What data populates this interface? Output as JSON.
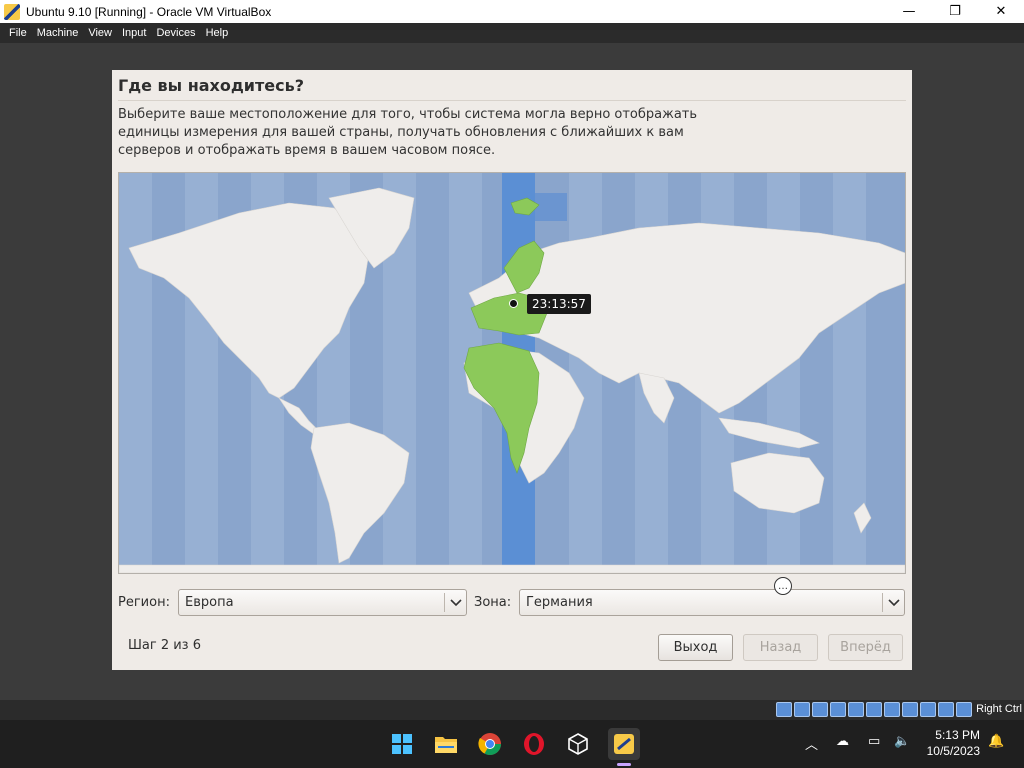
{
  "window": {
    "title": "Ubuntu 9.10 [Running] - Oracle VM VirtualBox",
    "minimize": "—",
    "restore": "❐",
    "close": "✕"
  },
  "menubar": [
    "File",
    "Machine",
    "View",
    "Input",
    "Devices",
    "Help"
  ],
  "installer": {
    "heading": "Где вы находитесь?",
    "description": "Выберите ваше местоположение для того, чтобы система могла верно отображать единицы измерения для вашей страны, получать обновления с ближайших к вам серверов и отображать время в вашем часовом поясе.",
    "map": {
      "time": "23:13:57"
    },
    "region_label": "Регион:",
    "region_value": "Европа",
    "zone_label": "Зона:",
    "zone_value": "Германия",
    "step": "Шаг 2 из 6",
    "buttons": {
      "quit": "Выход",
      "back": "Назад",
      "forward": "Вперёд"
    }
  },
  "vbox_status": {
    "host_key": "Right Ctrl"
  },
  "taskbar": {
    "icons": [
      "windows-start-icon",
      "file-explorer-icon",
      "chrome-icon",
      "opera-icon",
      "virtualbox-icon",
      "virtualbox-vm-icon"
    ],
    "clock_time": "5:13 PM",
    "clock_date": "10/5/2023"
  },
  "colors": {
    "map_ocean": "#8aa5cc",
    "map_land": "#efedeb",
    "map_selected_tz": "#5b8fd4",
    "map_highlight_land": "#8cc95a",
    "dialog_bg": "#efebe7"
  }
}
